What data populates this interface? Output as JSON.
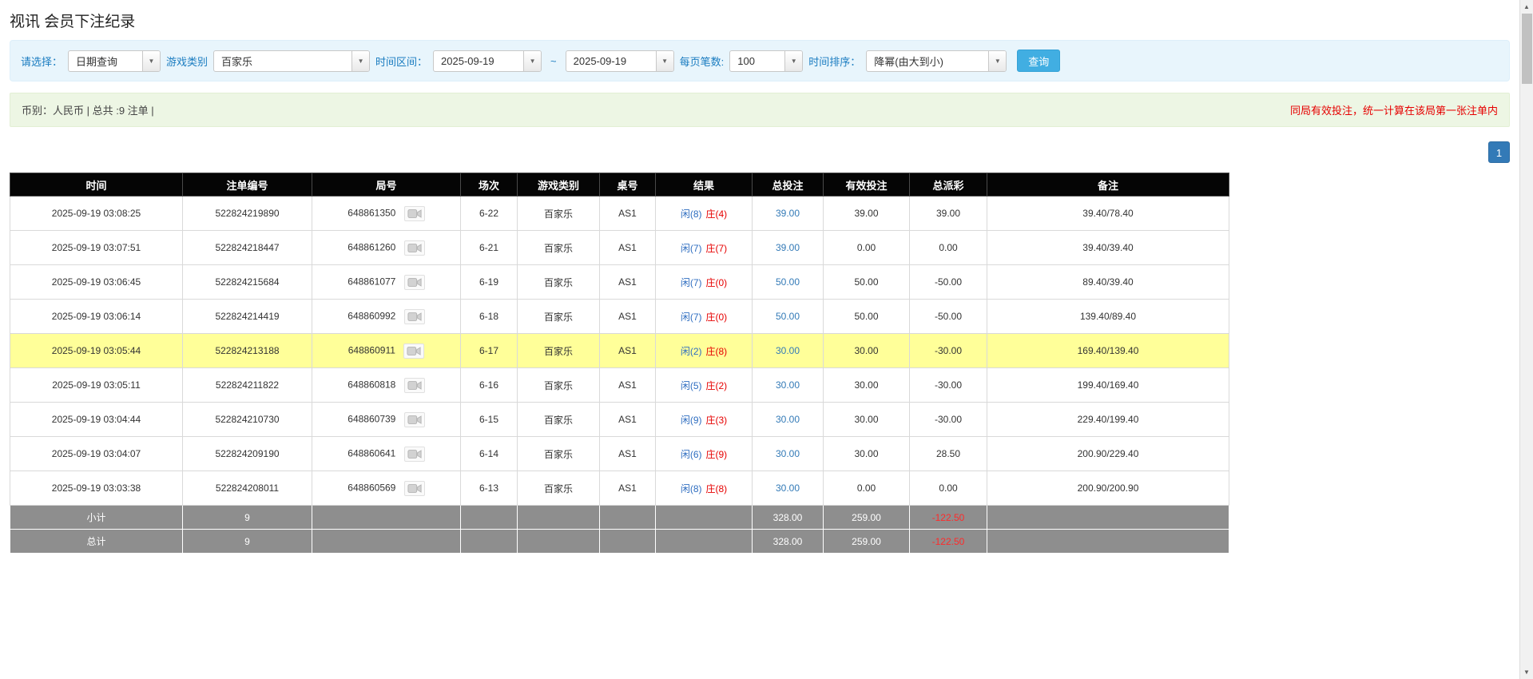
{
  "page": {
    "title": "视讯 会员下注纪录"
  },
  "colors": {
    "accent_blue": "#337ab7",
    "link_blue": "#337ab7",
    "label_blue": "#1a7cc0",
    "red": "#e60000",
    "highlight_yellow": "#ffff99",
    "header_bg": "#050505",
    "footer_bg": "#8e8e8e",
    "button_blue": "#41aee2",
    "filter_bg": "#e8f5fc",
    "info_bg": "#edf6e4"
  },
  "icons": {
    "combo_arrow": "▼",
    "scroll_up": "▲",
    "scroll_down": "▼",
    "video_icon": "video-replay-icon"
  },
  "filters": {
    "select_label": "请选择：",
    "select_value": "日期查询",
    "game_label": "游戏类别",
    "game_value": "百家乐",
    "range_label": "时间区间：",
    "date_from": "2025-09-19",
    "range_separator": "~",
    "date_to": "2025-09-19",
    "page_size_label": "每页笔数:",
    "page_size_value": "100",
    "sort_label": "时间排序：",
    "sort_value": "降幂(由大到小)",
    "search_button_label": "查询"
  },
  "summary_bar": {
    "left_text": "币别：人民币 | 总共 :9 注单 |",
    "right_notice": "同局有效投注，统一计算在该局第一张注单内"
  },
  "pagination": {
    "current": "1"
  },
  "table": {
    "headers": [
      "时间",
      "注单编号",
      "局号",
      "场次",
      "游戏类别",
      "桌号",
      "结果",
      "总投注",
      "有效投注",
      "总派彩",
      "备注"
    ],
    "rows": [
      {
        "time": "2025-09-19 03:08:25",
        "bet_id": "522824219890",
        "round_id": "648861350",
        "session": "6-22",
        "game": "百家乐",
        "table_no": "AS1",
        "result_player": "闲(8)",
        "result_banker": "庄(4)",
        "total_bet": "39.00",
        "valid_bet": "39.00",
        "payout": "39.00",
        "note": "39.40/78.40",
        "highlight": false
      },
      {
        "time": "2025-09-19 03:07:51",
        "bet_id": "522824218447",
        "round_id": "648861260",
        "session": "6-21",
        "game": "百家乐",
        "table_no": "AS1",
        "result_player": "闲(7)",
        "result_banker": "庄(7)",
        "total_bet": "39.00",
        "valid_bet": "0.00",
        "payout": "0.00",
        "note": "39.40/39.40",
        "highlight": false
      },
      {
        "time": "2025-09-19 03:06:45",
        "bet_id": "522824215684",
        "round_id": "648861077",
        "session": "6-19",
        "game": "百家乐",
        "table_no": "AS1",
        "result_player": "闲(7)",
        "result_banker": "庄(0)",
        "total_bet": "50.00",
        "valid_bet": "50.00",
        "payout": "-50.00",
        "note": "89.40/39.40",
        "highlight": false
      },
      {
        "time": "2025-09-19 03:06:14",
        "bet_id": "522824214419",
        "round_id": "648860992",
        "session": "6-18",
        "game": "百家乐",
        "table_no": "AS1",
        "result_player": "闲(7)",
        "result_banker": "庄(0)",
        "total_bet": "50.00",
        "valid_bet": "50.00",
        "payout": "-50.00",
        "note": "139.40/89.40",
        "highlight": false
      },
      {
        "time": "2025-09-19 03:05:44",
        "bet_id": "522824213188",
        "round_id": "648860911",
        "session": "6-17",
        "game": "百家乐",
        "table_no": "AS1",
        "result_player": "闲(2)",
        "result_banker": "庄(8)",
        "total_bet": "30.00",
        "valid_bet": "30.00",
        "payout": "-30.00",
        "note": "169.40/139.40",
        "highlight": true
      },
      {
        "time": "2025-09-19 03:05:11",
        "bet_id": "522824211822",
        "round_id": "648860818",
        "session": "6-16",
        "game": "百家乐",
        "table_no": "AS1",
        "result_player": "闲(5)",
        "result_banker": "庄(2)",
        "total_bet": "30.00",
        "valid_bet": "30.00",
        "payout": "-30.00",
        "note": "199.40/169.40",
        "highlight": false
      },
      {
        "time": "2025-09-19 03:04:44",
        "bet_id": "522824210730",
        "round_id": "648860739",
        "session": "6-15",
        "game": "百家乐",
        "table_no": "AS1",
        "result_player": "闲(9)",
        "result_banker": "庄(3)",
        "total_bet": "30.00",
        "valid_bet": "30.00",
        "payout": "-30.00",
        "note": "229.40/199.40",
        "highlight": false
      },
      {
        "time": "2025-09-19 03:04:07",
        "bet_id": "522824209190",
        "round_id": "648860641",
        "session": "6-14",
        "game": "百家乐",
        "table_no": "AS1",
        "result_player": "闲(6)",
        "result_banker": "庄(9)",
        "total_bet": "30.00",
        "valid_bet": "30.00",
        "payout": "28.50",
        "note": "200.90/229.40",
        "highlight": false
      },
      {
        "time": "2025-09-19 03:03:38",
        "bet_id": "522824208011",
        "round_id": "648860569",
        "session": "6-13",
        "game": "百家乐",
        "table_no": "AS1",
        "result_player": "闲(8)",
        "result_banker": "庄(8)",
        "total_bet": "30.00",
        "valid_bet": "0.00",
        "payout": "0.00",
        "note": "200.90/200.90",
        "highlight": false
      }
    ],
    "subtotal": {
      "label": "小计",
      "count": "9",
      "total_bet": "328.00",
      "valid_bet": "259.00",
      "payout": "-122.50"
    },
    "total": {
      "label": "总计",
      "count": "9",
      "total_bet": "328.00",
      "valid_bet": "259.00",
      "payout": "-122.50"
    }
  }
}
